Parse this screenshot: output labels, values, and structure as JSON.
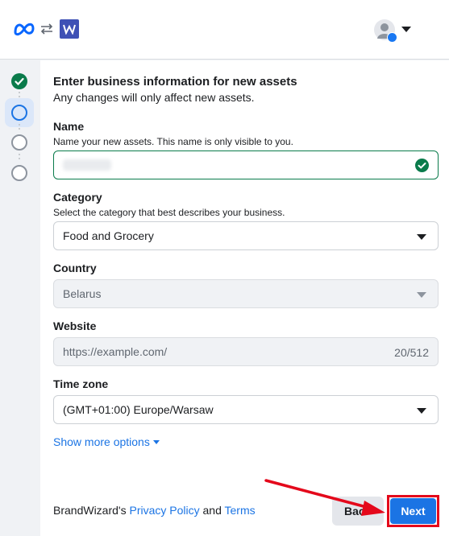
{
  "header": {
    "meta_logo_icon": "meta-logo",
    "swap_icon": "swap-arrows-icon",
    "app_logo_letter": "W",
    "account_icon": "account-avatar-icon"
  },
  "stepper": {
    "steps": [
      {
        "state": "done"
      },
      {
        "state": "active"
      },
      {
        "state": "pending"
      },
      {
        "state": "pending"
      }
    ]
  },
  "form": {
    "title": "Enter business information for new assets",
    "subtitle": "Any changes will only affect new assets.",
    "name": {
      "label": "Name",
      "helper": "Name your new assets. This name is only visible to you."
    },
    "category": {
      "label": "Category",
      "helper": "Select the category that best describes your business.",
      "value": "Food and Grocery"
    },
    "country": {
      "label": "Country",
      "value": "Belarus"
    },
    "website": {
      "label": "Website",
      "placeholder": "https://example.com/",
      "counter": "20/512"
    },
    "timezone": {
      "label": "Time zone",
      "value": "(GMT+01:00) Europe/Warsaw"
    },
    "more_options": "Show more options"
  },
  "footer": {
    "prefix": "BrandWizard's ",
    "privacy": "Privacy Policy",
    "and": " and ",
    "terms": "Terms",
    "back": "Bac",
    "next": "Next"
  },
  "colors": {
    "accent": "#1b74e4",
    "success": "#0a7b4b",
    "annotation": "#e4081b"
  }
}
